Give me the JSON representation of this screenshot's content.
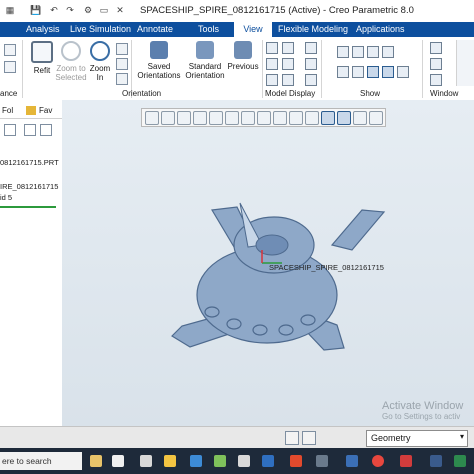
{
  "titlebar": {
    "title": "SPACESHIP_SPIRE_0812161715 (Active) - Creo Parametric 8.0",
    "icons": [
      "save-icon",
      "undo-icon",
      "redo-icon",
      "regenerate-icon",
      "window-icon",
      "close-window-icon"
    ]
  },
  "menu": {
    "tabs": [
      "Analysis",
      "Live Simulation",
      "Annotate",
      "Tools",
      "View",
      "Flexible Modeling",
      "Applications"
    ],
    "active": "View"
  },
  "ribbon": {
    "refit": "Refit",
    "zoom_to_selected_1": "Zoom to",
    "zoom_to_selected_2": "Selected",
    "zoom_in_1": "Zoom",
    "zoom_in_2": "In",
    "saved_orient_1": "Saved",
    "saved_orient_2": "Orientations",
    "standard_orient_1": "Standard",
    "standard_orient_2": "Orientation",
    "previous": "Previous",
    "group_orientation": "Orientation",
    "group_model_display": "Model Display",
    "group_show": "Show",
    "group_window": "Window",
    "group_left_fragment": "ance"
  },
  "left_panel": {
    "tab1": "Fol",
    "tab2": "Fav",
    "file_name": "0812161715.PRT",
    "tree_item_1": "IRE_0812161715",
    "tree_item_2": "id 5"
  },
  "viewport": {
    "model_label": "SPACESHIP_SPIRE_0812161715",
    "watermark_1": "Activate Window",
    "watermark_2": "Go to Settings to activ"
  },
  "statusbar": {
    "filter_value": "Geometry"
  },
  "taskbar": {
    "search_placeholder": "ere to search"
  },
  "colors": {
    "brand_blue": "#0d4f9e",
    "model_blue": "#8ea8c8",
    "selection_green": "#2c9a3c"
  }
}
